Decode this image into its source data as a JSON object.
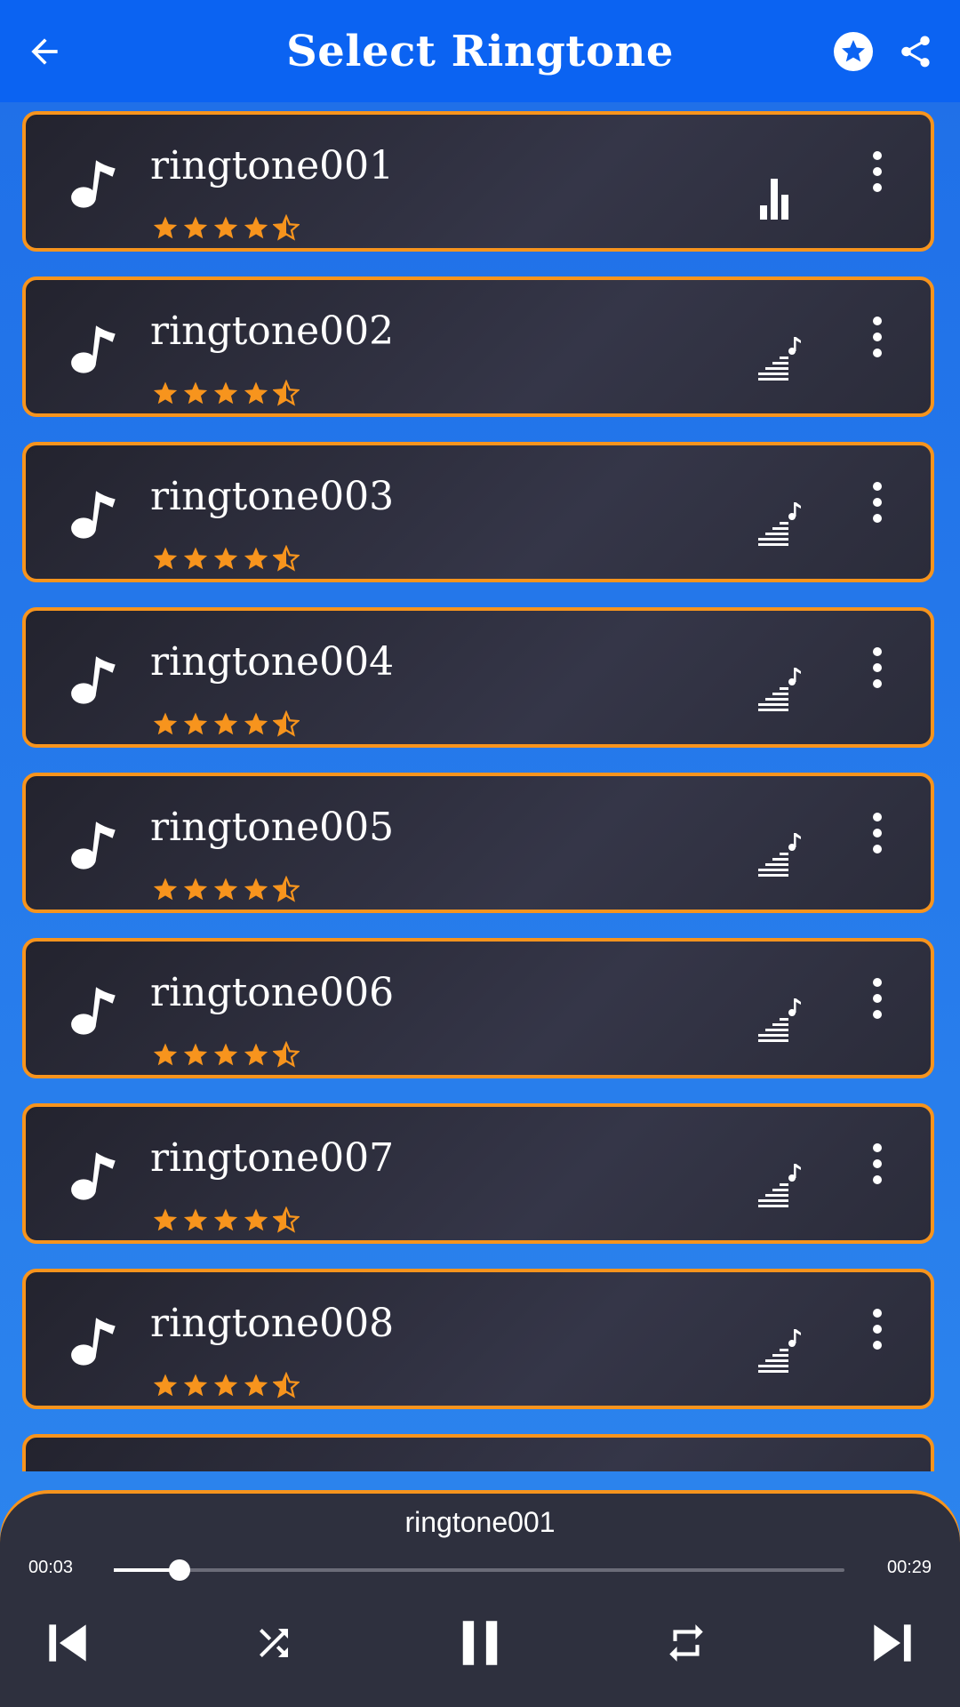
{
  "header": {
    "title": "Select Ringtone",
    "back_icon": "arrow-left-icon",
    "favorite_icon": "star-circle-icon",
    "share_icon": "share-icon"
  },
  "colors": {
    "appbar": "#0b63f2",
    "accent": "#f7941d",
    "card": "#2b2c3a",
    "text": "#ffffff"
  },
  "ringtones": [
    {
      "name": "ringtone001",
      "rating": 4.5,
      "playing": true
    },
    {
      "name": "ringtone002",
      "rating": 4.5,
      "playing": false
    },
    {
      "name": "ringtone003",
      "rating": 4.5,
      "playing": false
    },
    {
      "name": "ringtone004",
      "rating": 4.5,
      "playing": false
    },
    {
      "name": "ringtone005",
      "rating": 4.5,
      "playing": false
    },
    {
      "name": "ringtone006",
      "rating": 4.5,
      "playing": false
    },
    {
      "name": "ringtone007",
      "rating": 4.5,
      "playing": false
    },
    {
      "name": "ringtone008",
      "rating": 4.5,
      "playing": false
    }
  ],
  "player": {
    "track": "ringtone001",
    "current_time": "00:03",
    "total_time": "00:29",
    "progress": 0.09,
    "controls": [
      "skip-previous-icon",
      "shuffle-icon",
      "pause-icon",
      "repeat-icon",
      "skip-next-icon"
    ]
  }
}
